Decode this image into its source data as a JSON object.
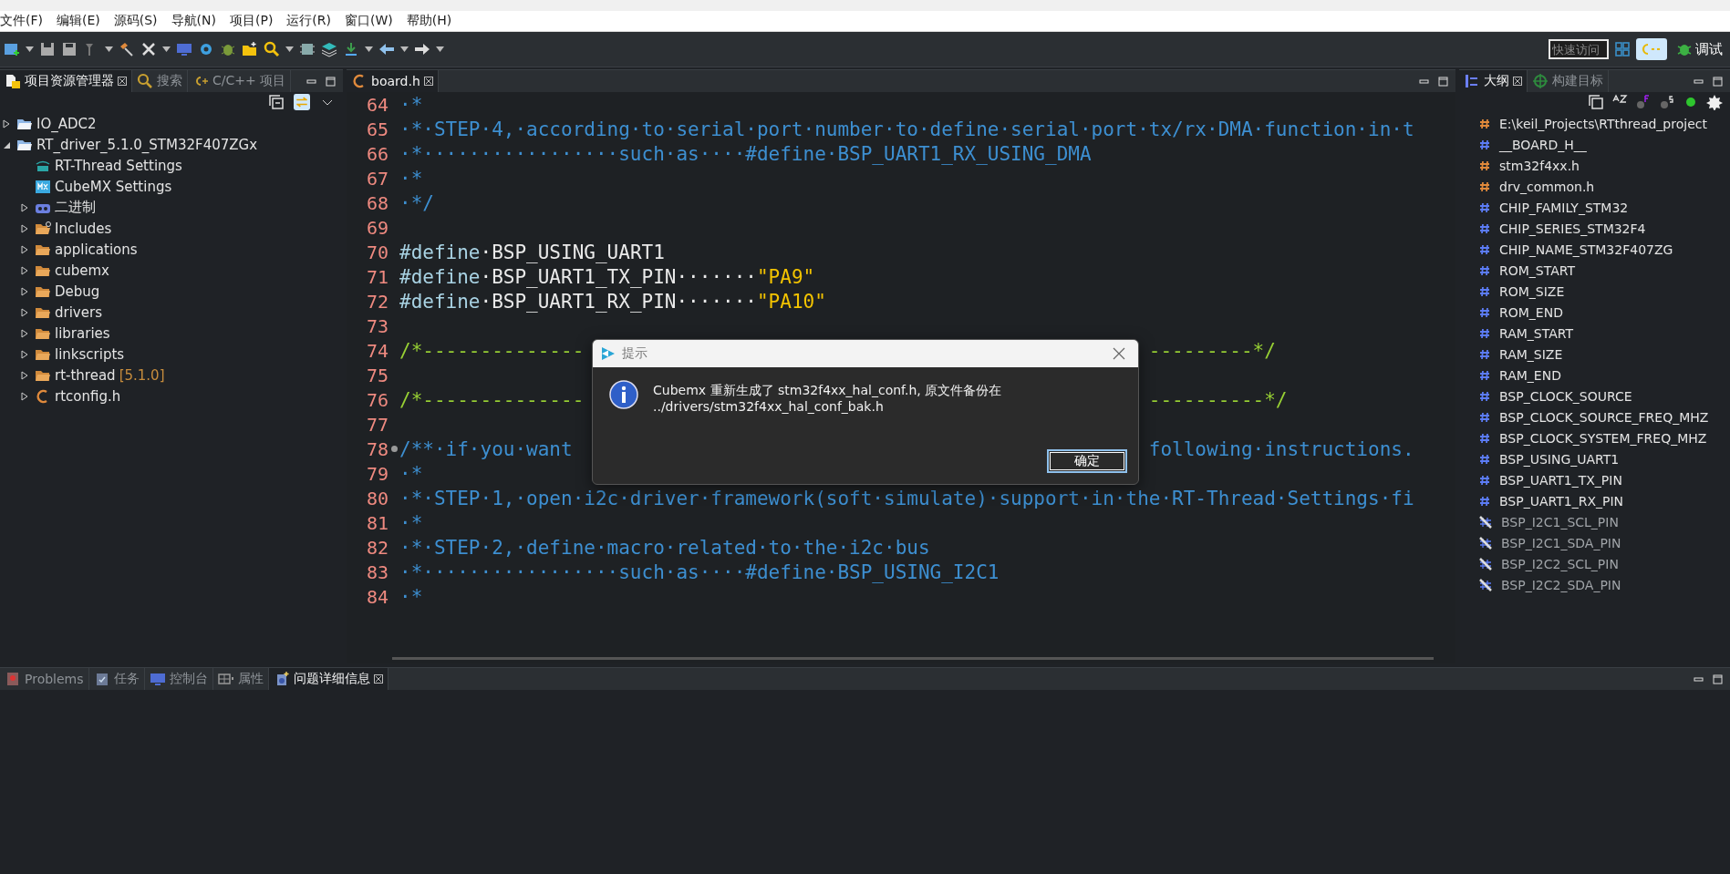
{
  "menu": [
    "文件(F)",
    "编辑(E)",
    "源码(S)",
    "导航(N)",
    "项目(P)",
    "运行(R)",
    "窗口(W)",
    "帮助(H)"
  ],
  "toolbar": {
    "quick_access": {
      "placeholder": "快速访问"
    },
    "perspectives": [
      {
        "kind": "cpp",
        "selected": true
      },
      {
        "kind": "debug",
        "label": "调试",
        "selected": false
      }
    ]
  },
  "explorer": {
    "tabs": [
      {
        "label": "项目资源管理器",
        "kind": "explorer",
        "selected": true
      },
      {
        "label": "搜索",
        "kind": "search",
        "selected": false
      },
      {
        "label": "C/C++ 项目",
        "kind": "cpp",
        "selected": false
      }
    ],
    "tree": [
      {
        "label": "IO_ADC2",
        "kind": "project",
        "expanded": false
      },
      {
        "label": "RT_driver_5.1.0_STM32F407ZGx",
        "kind": "project",
        "expanded": true,
        "children": [
          {
            "label": "RT-Thread Settings",
            "kind": "rt"
          },
          {
            "label": "CubeMX Settings",
            "kind": "mx"
          },
          {
            "label": "二进制",
            "kind": "binary",
            "expanded": false
          },
          {
            "label": "Includes",
            "kind": "includes",
            "expanded": false
          },
          {
            "label": "applications",
            "kind": "folder",
            "expanded": false
          },
          {
            "label": "cubemx",
            "kind": "folder",
            "expanded": false
          },
          {
            "label": "Debug",
            "kind": "folder",
            "expanded": false
          },
          {
            "label": "drivers",
            "kind": "folder",
            "expanded": false
          },
          {
            "label": "libraries",
            "kind": "folder",
            "expanded": false
          },
          {
            "label": "linkscripts",
            "kind": "folder",
            "expanded": false
          },
          {
            "label": "rt-thread",
            "decoration": "[5.1.0]",
            "kind": "folder",
            "expanded": false
          },
          {
            "label": "rtconfig.h",
            "kind": "cfile",
            "expanded": false
          }
        ]
      }
    ]
  },
  "editor": {
    "tab": {
      "label": "board.h",
      "selected": true
    },
    "lines": [
      {
        "number": "64",
        "segments": [
          {
            "kind": "comment",
            "text": "·*"
          }
        ]
      },
      {
        "number": "65",
        "segments": [
          {
            "kind": "comment",
            "text": "·*·STEP·4,·according·to·serial·port·number·to·define·serial·port·tx/rx·DMA·function·in·t"
          }
        ]
      },
      {
        "number": "66",
        "segments": [
          {
            "kind": "comment",
            "text": "·*·················such·as····#define·BSP_UART1_RX_USING_DMA"
          }
        ]
      },
      {
        "number": "67",
        "segments": [
          {
            "kind": "comment",
            "text": "·*"
          }
        ]
      },
      {
        "number": "68",
        "segments": [
          {
            "kind": "comment",
            "text": "·*/"
          }
        ]
      },
      {
        "number": "69"
      },
      {
        "number": "70",
        "segments": [
          {
            "kind": "directive",
            "text": "#define"
          },
          {
            "kind": "macro",
            "text": "·BSP_USING_UART1"
          }
        ]
      },
      {
        "number": "71",
        "segments": [
          {
            "kind": "directive",
            "text": "#define"
          },
          {
            "kind": "macro",
            "text": "·BSP_UART1_TX_PIN·······"
          },
          {
            "kind": "string",
            "text": "\"PA9\""
          }
        ]
      },
      {
        "number": "72",
        "segments": [
          {
            "kind": "directive",
            "text": "#define"
          },
          {
            "kind": "macro",
            "text": "·BSP_UART1_RX_PIN·······"
          },
          {
            "kind": "string",
            "text": "\"PA10\""
          }
        ]
      },
      {
        "number": "73"
      },
      {
        "number": "74",
        "segments": [
          {
            "kind": "divider",
            "text": "/*--------------"
          }
        ],
        "tail": {
          "kind": "divider",
          "text": "---------*/"
        }
      },
      {
        "number": "75"
      },
      {
        "number": "76",
        "segments": [
          {
            "kind": "divider",
            "text": "/*--------------"
          }
        ],
        "tail": {
          "kind": "divider",
          "text": "----------*/"
        }
      },
      {
        "number": "77"
      },
      {
        "number": "78",
        "folded": false,
        "segments": [
          {
            "kind": "comment",
            "text": "/**·if·you·want"
          }
        ],
        "tail": {
          "kind": "comment",
          "text": "following·instructions."
        }
      },
      {
        "number": "79",
        "segments": [
          {
            "kind": "comment",
            "text": "·*"
          }
        ]
      },
      {
        "number": "80",
        "segments": [
          {
            "kind": "comment",
            "text": "·*·STEP·1,·open·i2c·driver·framework(soft·simulate)·support·in·the·RT-Thread·Settings·fi"
          }
        ]
      },
      {
        "number": "81",
        "segments": [
          {
            "kind": "comment",
            "text": "·*"
          }
        ]
      },
      {
        "number": "82",
        "segments": [
          {
            "kind": "comment",
            "text": "·*·STEP·2,·define·macro·related·to·the·i2c·bus"
          }
        ]
      },
      {
        "number": "83",
        "segments": [
          {
            "kind": "comment",
            "text": "·*·················such·as····#define·BSP_USING_I2C1"
          }
        ]
      },
      {
        "number": "84",
        "segments": [
          {
            "kind": "comment",
            "text": "·*"
          }
        ]
      }
    ]
  },
  "outline": {
    "tabs": [
      {
        "label": "大纲",
        "kind": "outline",
        "selected": true
      },
      {
        "label": "构建目标",
        "kind": "target",
        "selected": false
      }
    ],
    "items": [
      {
        "label": "E:\\keil_Projects\\RTthread_project",
        "kind": "include"
      },
      {
        "label": "__BOARD_H__",
        "kind": "macro"
      },
      {
        "label": "stm32f4xx.h",
        "kind": "include"
      },
      {
        "label": "drv_common.h",
        "kind": "include"
      },
      {
        "label": "CHIP_FAMILY_STM32",
        "kind": "macro"
      },
      {
        "label": "CHIP_SERIES_STM32F4",
        "kind": "macro"
      },
      {
        "label": "CHIP_NAME_STM32F407ZG",
        "kind": "macro"
      },
      {
        "label": "ROM_START",
        "kind": "macro"
      },
      {
        "label": "ROM_SIZE",
        "kind": "macro"
      },
      {
        "label": "ROM_END",
        "kind": "macro"
      },
      {
        "label": "RAM_START",
        "kind": "macro"
      },
      {
        "label": "RAM_SIZE",
        "kind": "macro"
      },
      {
        "label": "RAM_END",
        "kind": "macro"
      },
      {
        "label": "BSP_CLOCK_SOURCE",
        "kind": "macro"
      },
      {
        "label": "BSP_CLOCK_SOURCE_FREQ_MHZ",
        "kind": "macro"
      },
      {
        "label": "BSP_CLOCK_SYSTEM_FREQ_MHZ",
        "kind": "macro"
      },
      {
        "label": "BSP_USING_UART1",
        "kind": "macro"
      },
      {
        "label": "BSP_UART1_TX_PIN",
        "kind": "macro"
      },
      {
        "label": "BSP_UART1_RX_PIN",
        "kind": "macro"
      },
      {
        "label": "BSP_I2C1_SCL_PIN",
        "kind": "inactive"
      },
      {
        "label": "BSP_I2C1_SDA_PIN",
        "kind": "inactive"
      },
      {
        "label": "BSP_I2C2_SCL_PIN",
        "kind": "inactive"
      },
      {
        "label": "BSP_I2C2_SDA_PIN",
        "kind": "inactive"
      }
    ]
  },
  "bottom": {
    "tabs": [
      {
        "label": "Problems",
        "kind": "problems",
        "selected": false
      },
      {
        "label": "任务",
        "kind": "tasks",
        "selected": false
      },
      {
        "label": "控制台",
        "kind": "console",
        "selected": false
      },
      {
        "label": "属性",
        "kind": "properties",
        "selected": false
      },
      {
        "label": "问题详细信息",
        "kind": "details",
        "selected": true
      }
    ]
  },
  "dialog": {
    "title": "提示",
    "message_lines": [
      "Cubemx 重新生成了 stm32f4xx_hal_conf.h, 原文件备份在",
      "../drivers/stm32f4xx_hal_conf_bak.h"
    ],
    "button": "确定"
  }
}
